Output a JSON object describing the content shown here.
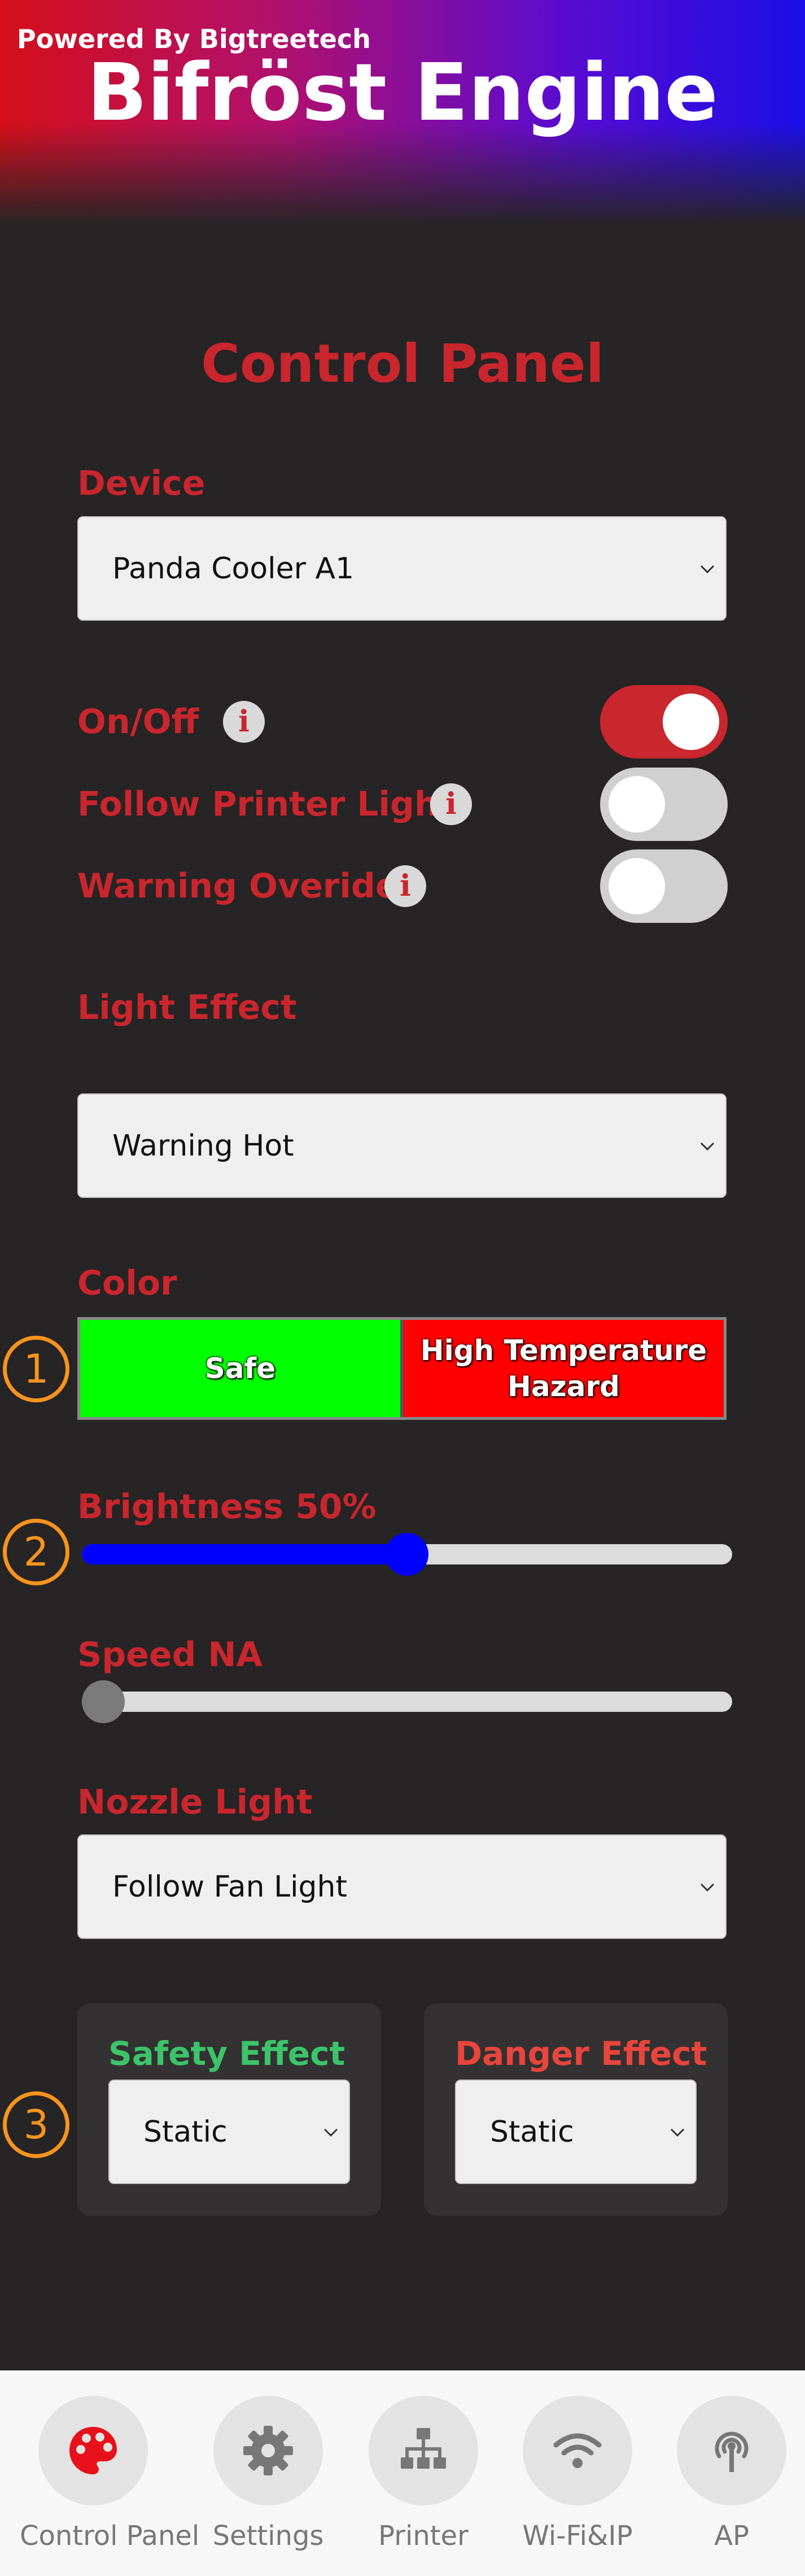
{
  "header": {
    "powered_by": "Powered By Bigtreetech",
    "brand": "Bifröst Engine"
  },
  "page_title": "Control Panel",
  "device": {
    "label": "Device",
    "selected": "Panda Cooler A1"
  },
  "toggles": {
    "on_off": {
      "label": "On/Off",
      "state": true
    },
    "follow_printer_light": {
      "label": "Follow Printer Light",
      "state": false
    },
    "warning_overide": {
      "label": "Warning Overide",
      "state": false
    },
    "info_glyph": "i"
  },
  "light_effect": {
    "label": "Light Effect",
    "selected": "Warning Hot"
  },
  "color": {
    "label": "Color",
    "safe": {
      "label": "Safe",
      "color": "#00ff00"
    },
    "danger": {
      "label": "High Temperature Hazard",
      "color": "#ff0000"
    }
  },
  "brightness": {
    "label": "Brightness 50%",
    "value": 0.5,
    "color": "#0000ff"
  },
  "speed": {
    "label": "Speed NA",
    "value": 0.0
  },
  "nozzle_light": {
    "label": "Nozzle Light",
    "selected": "Follow Fan Light"
  },
  "safety_effect": {
    "label": "Safety Effect",
    "selected": "Static",
    "color": "#3cc46a"
  },
  "danger_effect": {
    "label": "Danger Effect",
    "selected": "Static",
    "color": "#e8453c"
  },
  "markers": [
    "1",
    "2",
    "3"
  ],
  "nav": [
    {
      "label": "Control Panel",
      "icon": "palette-icon",
      "active": true
    },
    {
      "label": "Settings",
      "icon": "gear-icon"
    },
    {
      "label": "Printer",
      "icon": "network-tree-icon"
    },
    {
      "label": "Wi-Fi&IP",
      "icon": "wifi-icon"
    },
    {
      "label": "AP",
      "icon": "access-point-icon"
    }
  ],
  "colors": {
    "accent": "#c9262e",
    "background": "#262425",
    "marker": "#f7941d"
  }
}
